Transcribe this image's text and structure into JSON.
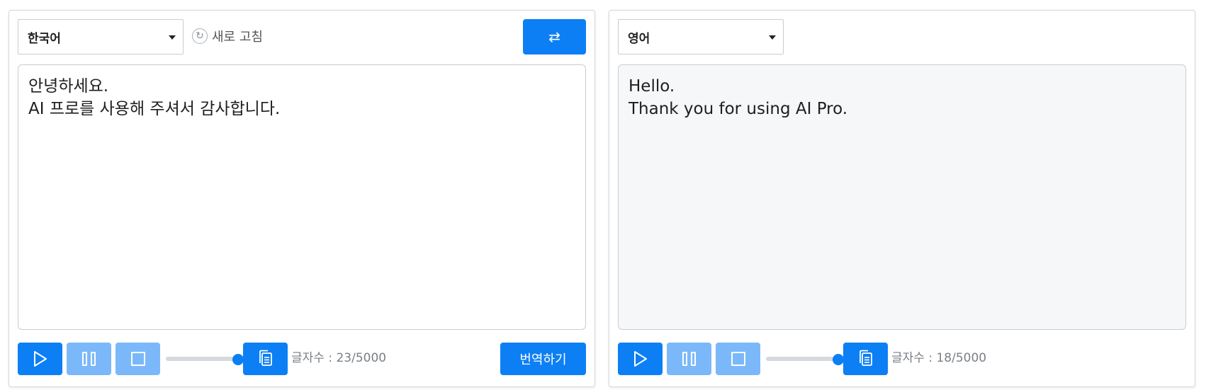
{
  "colors": {
    "accent": "#0d7ff5",
    "accent_disabled": "#7bb8f9",
    "target_bg": "#f6f7f9"
  },
  "source": {
    "language": "한국어",
    "refresh_label": "새로 고침",
    "swap_icon": "⇄",
    "lines": [
      "안녕하세요.",
      "AI 프로를 사용해 주셔서 감사합니다."
    ],
    "char_count": "글자수 : 23/5000",
    "speed_level": 1.0,
    "translate_label": "번역하기"
  },
  "target": {
    "language": "영어",
    "lines": [
      "Hello.",
      "Thank you for using AI Pro."
    ],
    "char_count": "글자수 : 18/5000",
    "speed_level": 1.0
  },
  "icons": {
    "play": "play-icon",
    "pause": "pause-icon",
    "stop": "stop-icon",
    "copy": "copy-icon",
    "refresh": "refresh-icon",
    "swap": "swap-icon",
    "dropdown": "chevron-down-icon"
  }
}
